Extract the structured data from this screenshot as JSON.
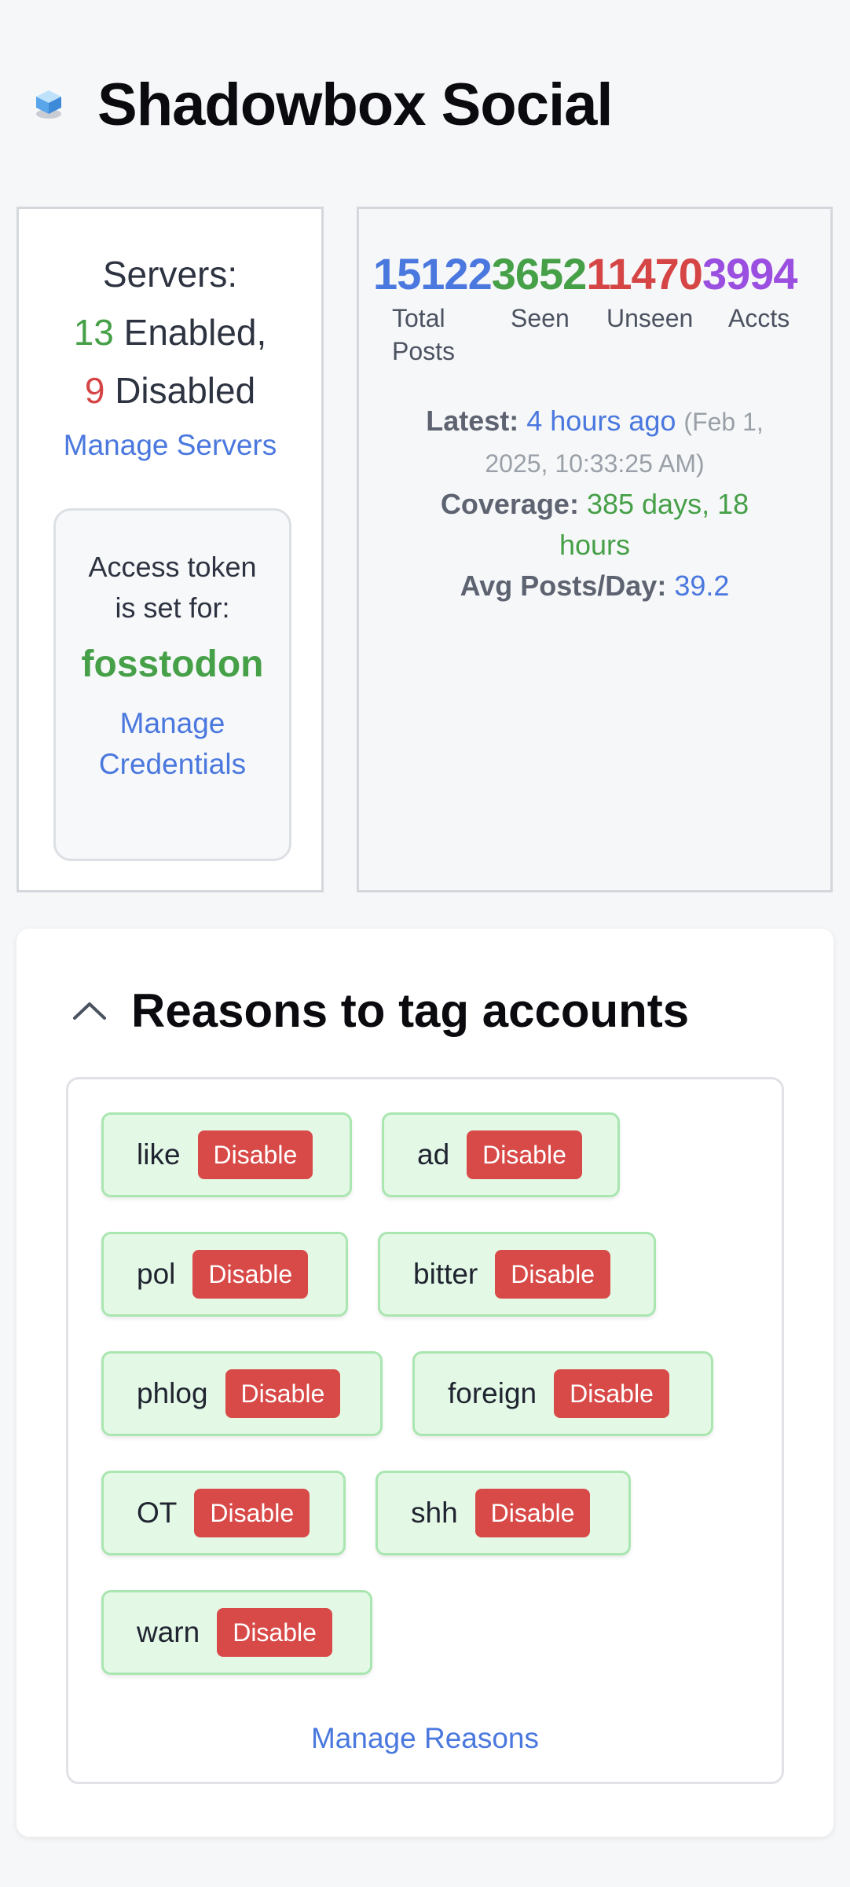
{
  "app": {
    "title": "Shadowbox Social"
  },
  "servers": {
    "label": "Servers:",
    "enabled_count": "13",
    "enabled_label": "Enabled,",
    "disabled_count": "9",
    "disabled_label": "Disabled",
    "manage_link": "Manage Servers"
  },
  "token": {
    "text": "Access token is set for:",
    "server": "fosstodon",
    "manage_link": "Manage Credentials"
  },
  "stats": {
    "total": "15122",
    "total_label": "Total Posts",
    "seen": "3652",
    "seen_label": "Seen",
    "unseen": "11470",
    "unseen_label": "Unseen",
    "accts": "3994",
    "accts_label": "Accts",
    "latest_label": "Latest:",
    "latest_value": "4 hours ago",
    "latest_date": "(Feb 1, 2025, 10:33:25 AM)",
    "coverage_label": "Coverage:",
    "coverage_value": "385 days, 18 hours",
    "avg_label": "Avg Posts/Day:",
    "avg_value": "39.2"
  },
  "reasons": {
    "title": "Reasons to tag accounts",
    "button_label": "Disable",
    "items": [
      "like",
      "ad",
      "pol",
      "bitter",
      "phlog",
      "foreign",
      "OT",
      "shh",
      "warn"
    ],
    "manage_link": "Manage Reasons"
  },
  "colors": {
    "green": "#46a048",
    "red": "#d64545",
    "blue": "#4a78de",
    "purple": "#9a4fe0",
    "chip_bg": "#e4f8e6",
    "disable_bg": "#d84a48"
  },
  "icons": {
    "logo": "cube-logo-icon",
    "collapse": "chevron-up-icon"
  }
}
